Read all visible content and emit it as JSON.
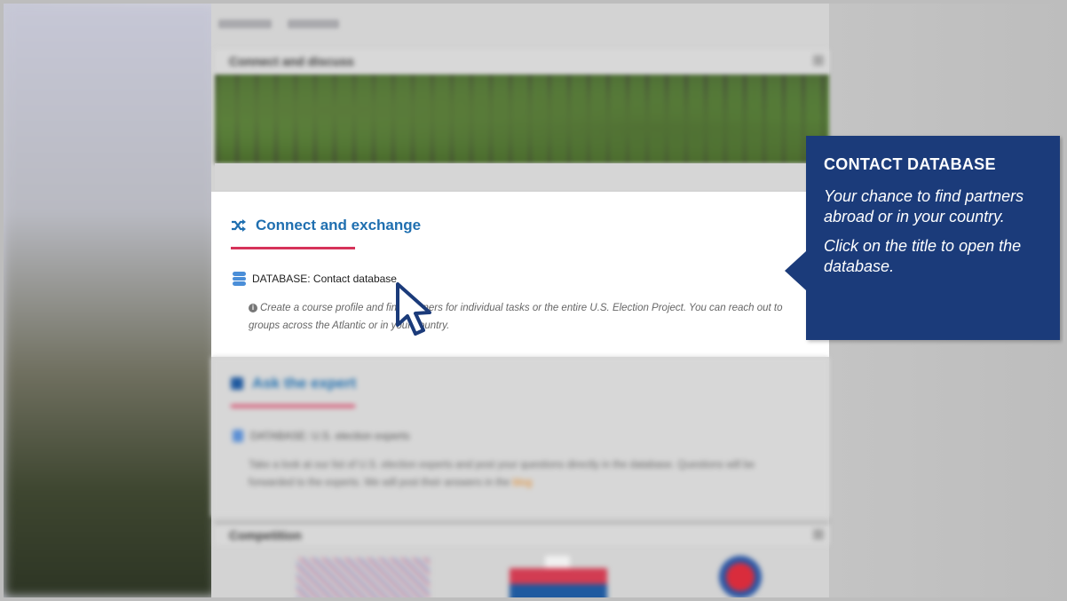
{
  "page": {
    "topbar_items": [
      "",
      ""
    ],
    "connect_discuss": {
      "title": "Connect and discuss"
    },
    "connect_exchange": {
      "title": "Connect and exchange",
      "database_link": "DATABASE: Contact database",
      "description": "Create a course profile and find partners for individual tasks or the entire U.S. Election Project. You can reach out to groups across the Atlantic or in your country."
    },
    "ask_expert": {
      "title": "Ask the expert",
      "database_link": "DATABASE: U.S. election experts",
      "description": "Take a look at our list of U.S. election experts and post your questions directly in the database. Questions will be forwarded to the experts. We will post their answers in the ",
      "blog_link": "blog"
    },
    "competition": {
      "title": "Competition"
    }
  },
  "callout": {
    "title": "CONTACT DATABASE",
    "line1": "Your chance to find partners abroad or in your country.",
    "line2": "Click on the title to open the database."
  },
  "colors": {
    "accent_blue": "#1f6fb0",
    "callout_bg": "#1b3b7a",
    "underline_red": "#d6335a"
  },
  "icons": {
    "shuffle": "shuffle-icon",
    "database": "database-icon",
    "info": "info-icon",
    "cursor": "mouse-pointer-icon"
  }
}
